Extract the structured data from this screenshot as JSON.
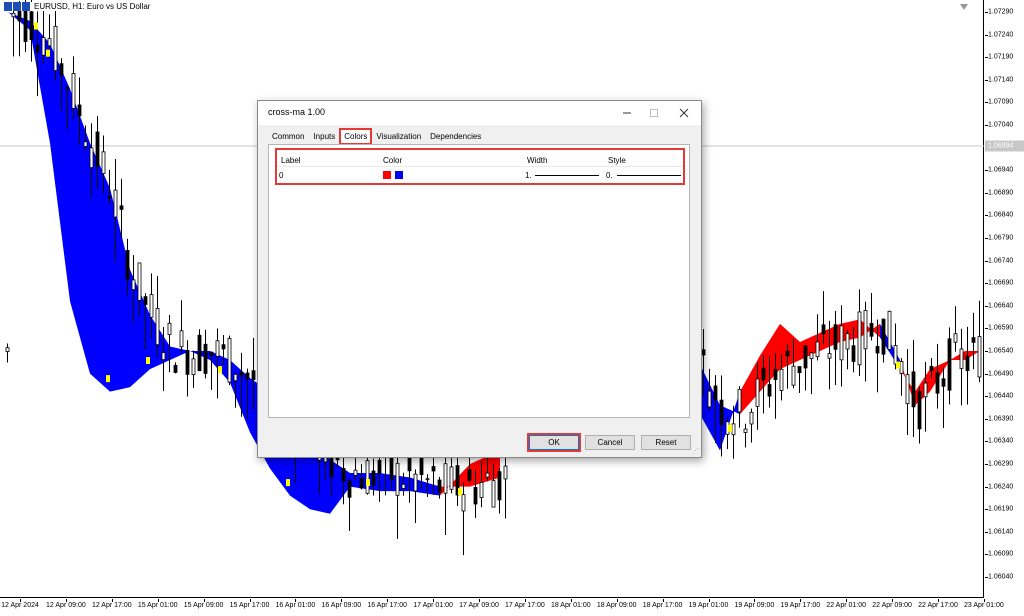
{
  "chart": {
    "symbol_title": "EURUSD, H1:  Euro vs US Dollar",
    "price_labels": [
      "1.07290",
      "1.07240",
      "1.07190",
      "1.07140",
      "1.07090",
      "1.07040",
      "1.06994",
      "1.06940",
      "1.06890",
      "1.06840",
      "1.06790",
      "1.06740",
      "1.06690",
      "1.06640",
      "1.06590",
      "1.06540",
      "1.06490",
      "1.06440",
      "1.06390",
      "1.06340",
      "1.06290",
      "1.06240",
      "1.06190",
      "1.06140",
      "1.06090",
      "1.06040"
    ],
    "current_price": "1.06994",
    "time_labels": [
      "12 Apr 2024",
      "12 Apr 09:00",
      "12 Apr 17:00",
      "15 Apr 01:00",
      "15 Apr 09:00",
      "15 Apr 17:00",
      "16 Apr 01:00",
      "16 Apr 09:00",
      "16 Apr 17:00",
      "17 Apr 01:00",
      "17 Apr 09:00",
      "17 Apr 17:00",
      "18 Apr 01:00",
      "18 Apr 09:00",
      "18 Apr 17:00",
      "19 Apr 01:00",
      "19 Apr 09:00",
      "19 Apr 17:00",
      "22 Apr 01:00",
      "22 Apr 09:00",
      "22 Apr 17:00",
      "23 Apr 01:00"
    ],
    "colors": {
      "bull_band": "#0000ff",
      "bear_band": "#ff0000",
      "candle_up": "#ffffff",
      "candle_down": "#000000",
      "cross_mark": "#ffff00"
    }
  },
  "dialog": {
    "title": "cross-ma 1.00",
    "minimize_icon": "minimize-icon",
    "maximize_icon": "maximize-icon",
    "close_icon": "close-icon",
    "tabs": [
      {
        "label": "Common",
        "active": false
      },
      {
        "label": "Inputs",
        "active": false
      },
      {
        "label": "Colors",
        "active": true
      },
      {
        "label": "Visualization",
        "active": false
      },
      {
        "label": "Dependencies",
        "active": false
      }
    ],
    "colors_table": {
      "headers": {
        "label": "Label",
        "color": "Color",
        "width": "Width",
        "style": "Style"
      },
      "rows": [
        {
          "label": "0",
          "color1": "#ff0000",
          "color2": "#0000ff",
          "width": "1.",
          "style": "0."
        }
      ]
    },
    "buttons": {
      "ok": "OK",
      "cancel": "Cancel",
      "reset": "Reset"
    }
  }
}
